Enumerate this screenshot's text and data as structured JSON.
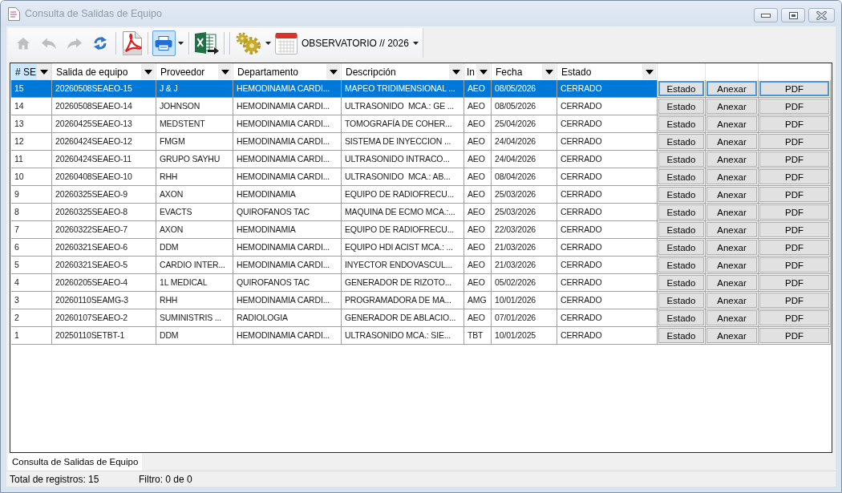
{
  "window": {
    "title": "Consulta de Salidas de Equipo"
  },
  "toolbar": {
    "buttons": [
      {
        "disabled": true,
        "selected": false
      },
      {
        "disabled": true,
        "selected": false
      },
      {
        "disabled": true,
        "selected": false
      },
      {
        "disabled": false,
        "selected": false
      },
      {
        "disabled": false,
        "selected": false
      },
      {
        "disabled": false,
        "selected": true
      },
      {
        "disabled": false,
        "selected": false
      },
      {
        "disabled": false,
        "selected": false
      }
    ],
    "period": {
      "label": "OBSERVATORIO // 2026"
    }
  },
  "table": {
    "columns": [
      {
        "label": "# SE",
        "selected": true
      },
      {
        "label": "Salida de equipo",
        "selected": false
      },
      {
        "label": "Proveedor",
        "selected": false
      },
      {
        "label": "Departamento",
        "selected": false
      },
      {
        "label": "Descripción",
        "selected": false
      },
      {
        "label": "In",
        "selected": false
      },
      {
        "label": "Fecha",
        "selected": false
      },
      {
        "label": "Estado",
        "selected": false
      }
    ],
    "rows": [
      {
        "selected": true,
        "cells": [
          "15",
          "20260508SEAEO-15",
          "J & J",
          "HEMODINAMIA CARDI...",
          "MAPEO TRIDIMENSIONAL ...",
          "AEO",
          "08/05/2026",
          "CERRADO"
        ],
        "actions": [
          "Estado",
          "Anexar",
          "PDF"
        ]
      },
      {
        "selected": false,
        "cells": [
          "14",
          "20260508SEAEO-14",
          "JOHNSON",
          "HEMODINAMIA CARDI...",
          "ULTRASONIDO  MCA.: GE ...",
          "AEO",
          "08/05/2026",
          "CERRADO"
        ],
        "actions": [
          "Estado",
          "Anexar",
          "PDF"
        ]
      },
      {
        "selected": false,
        "cells": [
          "13",
          "20260425SEAEO-13",
          "MEDSTENT",
          "HEMODINAMIA CARDI...",
          "TOMOGRAFÍA DE COHER...",
          "AEO",
          "25/04/2026",
          "CERRADO"
        ],
        "actions": [
          "Estado",
          "Anexar",
          "PDF"
        ]
      },
      {
        "selected": false,
        "cells": [
          "12",
          "20260424SEAEO-12",
          "FMGM",
          "HEMODINAMIA CARDI...",
          "SISTEMA DE INYECCION ...",
          "AEO",
          "24/04/2026",
          "CERRADO"
        ],
        "actions": [
          "Estado",
          "Anexar",
          "PDF"
        ]
      },
      {
        "selected": false,
        "cells": [
          "11",
          "20260424SEAEO-11",
          "GRUPO SAYHU",
          "HEMODINAMIA CARDI...",
          "ULTRASONIDO INTRACO...",
          "AEO",
          "24/04/2026",
          "CERRADO"
        ],
        "actions": [
          "Estado",
          "Anexar",
          "PDF"
        ]
      },
      {
        "selected": false,
        "cells": [
          "10",
          "20260408SEAEO-10",
          "RHH",
          "HEMODINAMIA CARDI...",
          "ULTRASONIDO  MCA.: AB...",
          "AEO",
          "08/04/2026",
          "CERRADO"
        ],
        "actions": [
          "Estado",
          "Anexar",
          "PDF"
        ]
      },
      {
        "selected": false,
        "cells": [
          "9",
          "20260325SEAEO-9",
          "AXON",
          "HEMODINAMIA",
          "EQUIPO DE RADIOFRECU...",
          "AEO",
          "25/03/2026",
          "CERRADO"
        ],
        "actions": [
          "Estado",
          "Anexar",
          "PDF"
        ]
      },
      {
        "selected": false,
        "cells": [
          "8",
          "20260325SEAEO-8",
          "EVACTS",
          "QUIROFANOS TAC",
          "MAQUINA DE ECMO MCA.:...",
          "AEO",
          "25/03/2026",
          "CERRADO"
        ],
        "actions": [
          "Estado",
          "Anexar",
          "PDF"
        ]
      },
      {
        "selected": false,
        "cells": [
          "7",
          "20260322SEAEO-7",
          "AXON",
          "HEMODINAMIA",
          "EQUIPO DE RADIOFRECU...",
          "AEO",
          "22/03/2026",
          "CERRADO"
        ],
        "actions": [
          "Estado",
          "Anexar",
          "PDF"
        ]
      },
      {
        "selected": false,
        "cells": [
          "6",
          "20260321SEAEO-6",
          "DDM",
          "HEMODINAMIA CARDI...",
          "EQUIPO HDI ACIST MCA.: ...",
          "AEO",
          "21/03/2026",
          "CERRADO"
        ],
        "actions": [
          "Estado",
          "Anexar",
          "PDF"
        ]
      },
      {
        "selected": false,
        "cells": [
          "5",
          "20260321SEAEO-5",
          "CARDIO INTER...",
          "HEMODINAMIA CARDI...",
          "INYECTOR ENDOVASCUL...",
          "AEO",
          "21/03/2026",
          "CERRADO"
        ],
        "actions": [
          "Estado",
          "Anexar",
          "PDF"
        ]
      },
      {
        "selected": false,
        "cells": [
          "4",
          "20260205SEAEO-4",
          "1L MEDICAL",
          "QUIROFANOS TAC",
          "GENERADOR DE RIZOTO...",
          "AEO",
          "05/02/2026",
          "CERRADO"
        ],
        "actions": [
          "Estado",
          "Anexar",
          "PDF"
        ]
      },
      {
        "selected": false,
        "cells": [
          "3",
          "20260110SEAMG-3",
          "RHH",
          "HEMODINAMIA CARDI...",
          "PROGRAMADORA DE MA...",
          "AMG",
          "10/01/2026",
          "CERRADO"
        ],
        "actions": [
          "Estado",
          "Anexar",
          "PDF"
        ]
      },
      {
        "selected": false,
        "cells": [
          "2",
          "20260107SEAEO-2",
          "SUMINISTRIS ...",
          "RADIOLOGIA",
          "GENERADOR DE ABLACIO...",
          "AEO",
          "07/01/2026",
          "CERRADO"
        ],
        "actions": [
          "Estado",
          "Anexar",
          "PDF"
        ]
      },
      {
        "selected": false,
        "cells": [
          "1",
          "20250110SETBT-1",
          "DDM",
          "HEMODINAMIA CARDI...",
          "ULTRASONIDO MCA.: SIE...",
          "TBT",
          "10/01/2025",
          "CERRADO"
        ],
        "actions": [
          "Estado",
          "Anexar",
          "PDF"
        ]
      }
    ]
  },
  "tabs": [
    {
      "label": "Consulta de Salidas de Equipo",
      "selected": true
    }
  ],
  "status_bar": {
    "total": "Total de registros: 15",
    "filter": "Filtro: 0 de 0"
  }
}
